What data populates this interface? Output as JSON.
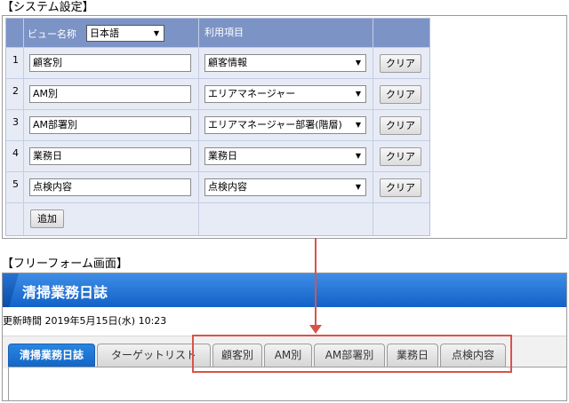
{
  "settings": {
    "section_title": "【システム設定】",
    "header": {
      "view_name_label": "ビュー名称",
      "language_value": "日本語",
      "items_label": "利用項目"
    },
    "rows": [
      {
        "num": "1",
        "name": "顧客別",
        "item": "顧客情報",
        "clear": "クリア"
      },
      {
        "num": "2",
        "name": "AM別",
        "item": "エリアマネージャー",
        "clear": "クリア"
      },
      {
        "num": "3",
        "name": "AM部署別",
        "item": "エリアマネージャー部署(階層)",
        "clear": "クリア"
      },
      {
        "num": "4",
        "name": "業務日",
        "item": "業務日",
        "clear": "クリア"
      },
      {
        "num": "5",
        "name": "点検内容",
        "item": "点検内容",
        "clear": "クリア"
      }
    ],
    "add_label": "追加"
  },
  "freeform": {
    "section_title": "【フリーフォーム画面】",
    "app_title": "清掃業務日誌",
    "updated_label": "更新時間",
    "updated_value": "2019年5月15日(水) 10:23",
    "tabs": [
      "清掃業務日誌",
      "ターゲットリスト",
      "顧客別",
      "AM別",
      "AM部署別",
      "業務日",
      "点検内容"
    ],
    "active_tab": "清掃業務日誌"
  },
  "colors": {
    "header_bg": "#7c93c5",
    "title_blue": "#1a72d8",
    "highlight_red": "#d9534a"
  }
}
